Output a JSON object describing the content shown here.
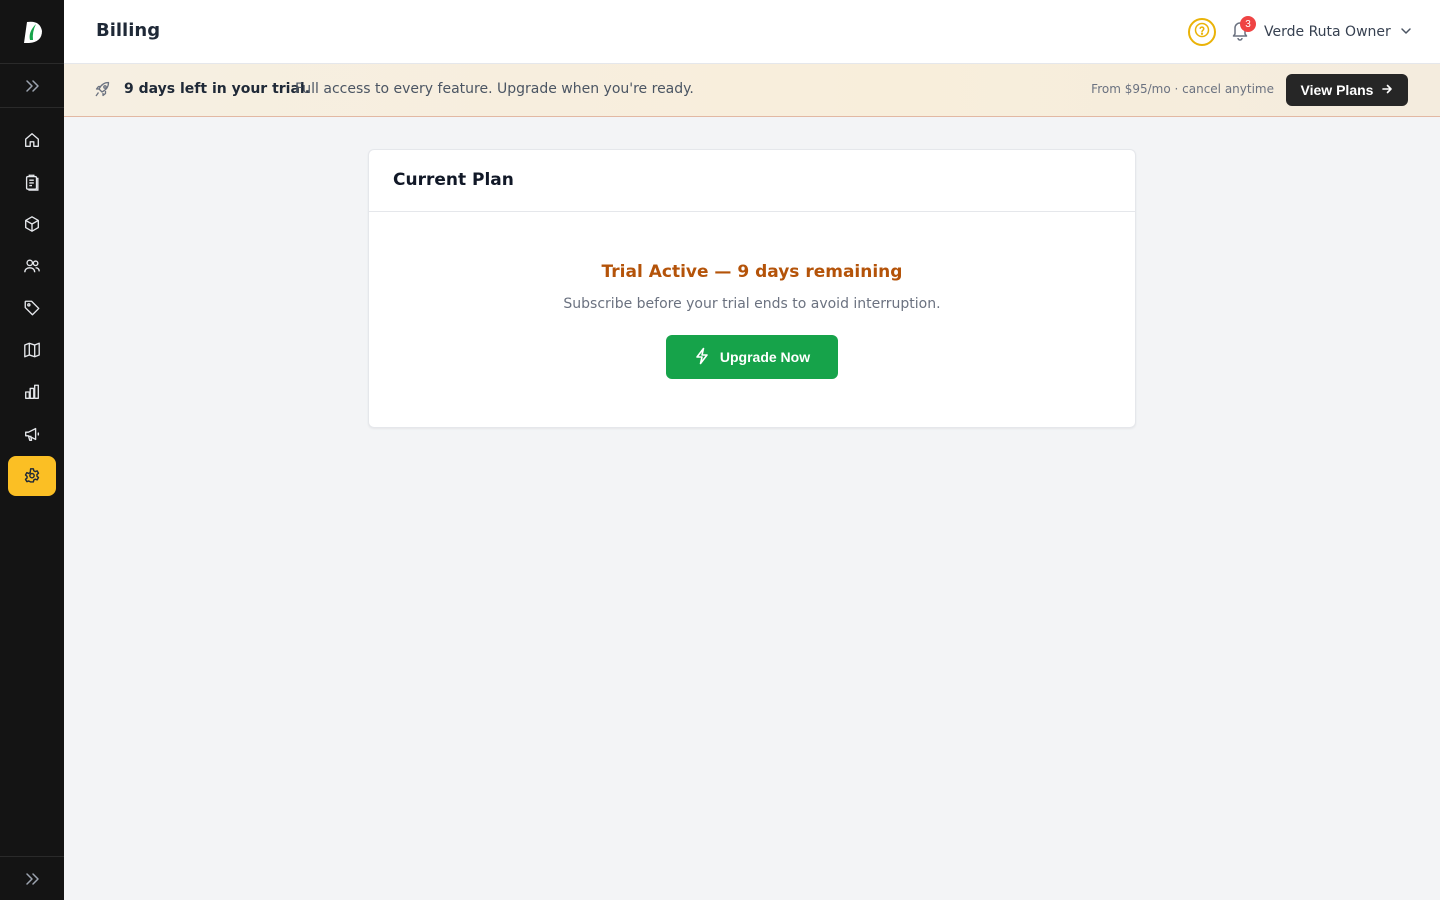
{
  "header": {
    "title": "Billing",
    "notification_count": "3",
    "user_name": "Verde Ruta Owner"
  },
  "sidebar": {
    "logo_icon": "brand-logo-icon",
    "items": [
      {
        "icon": "home-icon",
        "label": "Home"
      },
      {
        "icon": "clipboard-icon",
        "label": "Orders"
      },
      {
        "icon": "box-icon",
        "label": "Products"
      },
      {
        "icon": "users-icon",
        "label": "Customers"
      },
      {
        "icon": "tag-icon",
        "label": "Tags"
      },
      {
        "icon": "map-icon",
        "label": "Routes"
      },
      {
        "icon": "bar-chart-icon",
        "label": "Reports"
      },
      {
        "icon": "megaphone-icon",
        "label": "Marketing"
      },
      {
        "icon": "gear-icon",
        "label": "Settings",
        "active": true
      }
    ]
  },
  "banner": {
    "strong": "9 days left in your trial.",
    "text": "Full access to every feature. Upgrade when you're ready.",
    "price": "From $95/mo · cancel anytime",
    "button": "View Plans"
  },
  "card": {
    "title": "Current Plan",
    "status": "Trial Active — 9 days remaining",
    "subtitle": "Subscribe before your trial ends to avoid interruption.",
    "button": "Upgrade Now"
  },
  "colors": {
    "sidebar_bg": "#141414",
    "active_accent": "#fbbf24",
    "trial_status": "#b45309",
    "upgrade_button": "#16a34a",
    "badge": "#ef4444"
  }
}
